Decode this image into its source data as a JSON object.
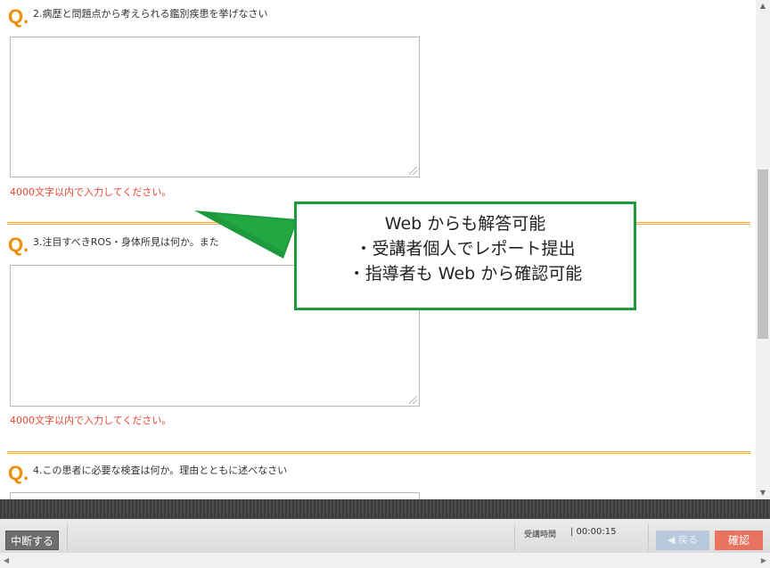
{
  "questions": [
    {
      "mark": "Q.",
      "text": "2.病歴と問題点から考えられる鑑別疾患を挙げなさい",
      "limit": "4000文字以内で入力してください。"
    },
    {
      "mark": "Q.",
      "text": "3.注目すべきROS・身体所見は何か。また",
      "limit": "4000文字以内で入力してください。"
    },
    {
      "mark": "Q.",
      "text": "4.この患者に必要な検査は何か。理由とともに述べなさい"
    }
  ],
  "callout": {
    "line1": "Web からも解答可能",
    "line2": "・受講者個人でレポート提出",
    "line3": "・指導者も Web から確認可能",
    "border_color": "#1d9b3c"
  },
  "toolbar": {
    "suspend_label": "中断する",
    "time_label": "受講時間",
    "time_value": "| 00:00:15",
    "back_label": "◀ 戻る",
    "confirm_label": "確認"
  },
  "colors": {
    "accent": "#f08c00",
    "warning": "#e8452e",
    "confirm": "#e8735f"
  },
  "icons": {
    "scroll_up": "triangle-up-icon",
    "scroll_down": "triangle-down-icon",
    "scroll_left": "triangle-left-icon",
    "scroll_right": "triangle-right-icon"
  }
}
